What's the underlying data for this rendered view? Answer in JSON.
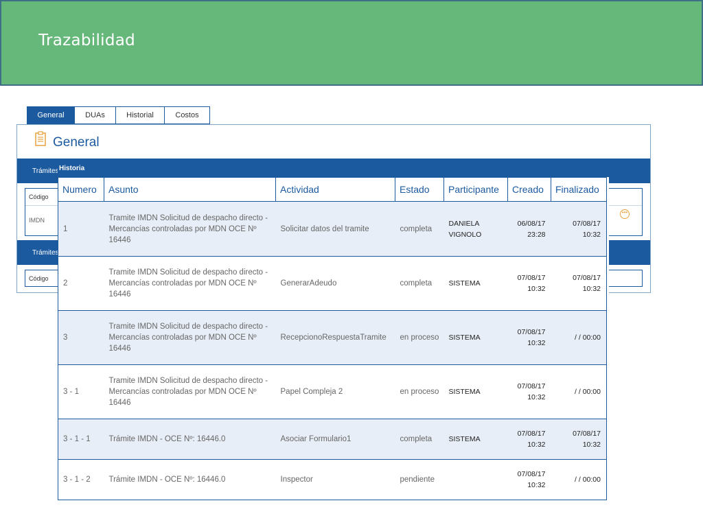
{
  "banner": {
    "title": "Trazabilidad"
  },
  "tabs": [
    {
      "label": "General",
      "active": true
    },
    {
      "label": "DUAs",
      "active": false
    },
    {
      "label": "Historial",
      "active": false
    },
    {
      "label": "Costos",
      "active": false
    }
  ],
  "general": {
    "title": "General",
    "section1_label": "Trámites",
    "section1_code_header": "Código",
    "section1_row_code": "IMDN",
    "section2_label": "Trámites",
    "section2_code_header": "Código"
  },
  "historia": {
    "title": "Historia",
    "headers": [
      "Numero",
      "Asunto",
      "Actividad",
      "Estado",
      "Participante",
      "Creado",
      "Finalizado"
    ],
    "rows": [
      {
        "numero": "1",
        "asunto": "Tramite IMDN Solicitud de despacho directo - Mercancías controladas por MDN OCE Nº 16446",
        "actividad": "Solicitar datos del tramite",
        "estado": "completa",
        "participante": "DANIELA VIGNOLO",
        "creado_date": "06/08/17",
        "creado_time": "23:28",
        "finalizado_date": "07/08/17",
        "finalizado_time": "10:32"
      },
      {
        "numero": "2",
        "asunto": "Tramite IMDN Solicitud de despacho directo - Mercancías controladas por MDN OCE Nº 16446",
        "actividad": "GenerarAdeudo",
        "estado": "completa",
        "participante": "SISTEMA",
        "creado_date": "07/08/17",
        "creado_time": "10:32",
        "finalizado_date": "07/08/17",
        "finalizado_time": "10:32"
      },
      {
        "numero": "3",
        "asunto": "Tramite IMDN Solicitud de despacho directo - Mercancías controladas por MDN OCE Nº 16446",
        "actividad": "RecepcionoRespuestaTramite",
        "estado": "en proceso",
        "participante": "SISTEMA",
        "creado_date": "07/08/17",
        "creado_time": "10:32",
        "finalizado_date": "/ / 00:00",
        "finalizado_time": ""
      },
      {
        "numero": "3 - 1",
        "asunto": "Tramite IMDN Solicitud de despacho directo - Mercancías controladas por MDN OCE Nº 16446",
        "actividad": "Papel Compleja 2",
        "estado": "en proceso",
        "participante": "SISTEMA",
        "creado_date": "07/08/17",
        "creado_time": "10:32",
        "finalizado_date": "/ / 00:00",
        "finalizado_time": ""
      },
      {
        "numero": "3 - 1 - 1",
        "asunto": "Trámite IMDN - OCE Nº: 16446.0",
        "actividad": "Asociar Formulario1",
        "estado": "completa",
        "participante": "SISTEMA",
        "creado_date": "07/08/17",
        "creado_time": "10:32",
        "finalizado_date": "07/08/17",
        "finalizado_time": "10:32"
      },
      {
        "numero": "3 - 1 - 2",
        "asunto": "Trámite IMDN - OCE Nº: 16446.0",
        "actividad": "Inspector",
        "estado": "pendiente",
        "participante": "",
        "creado_date": "07/08/17",
        "creado_time": "10:32",
        "finalizado_date": "/ / 00:00",
        "finalizado_time": ""
      }
    ]
  }
}
